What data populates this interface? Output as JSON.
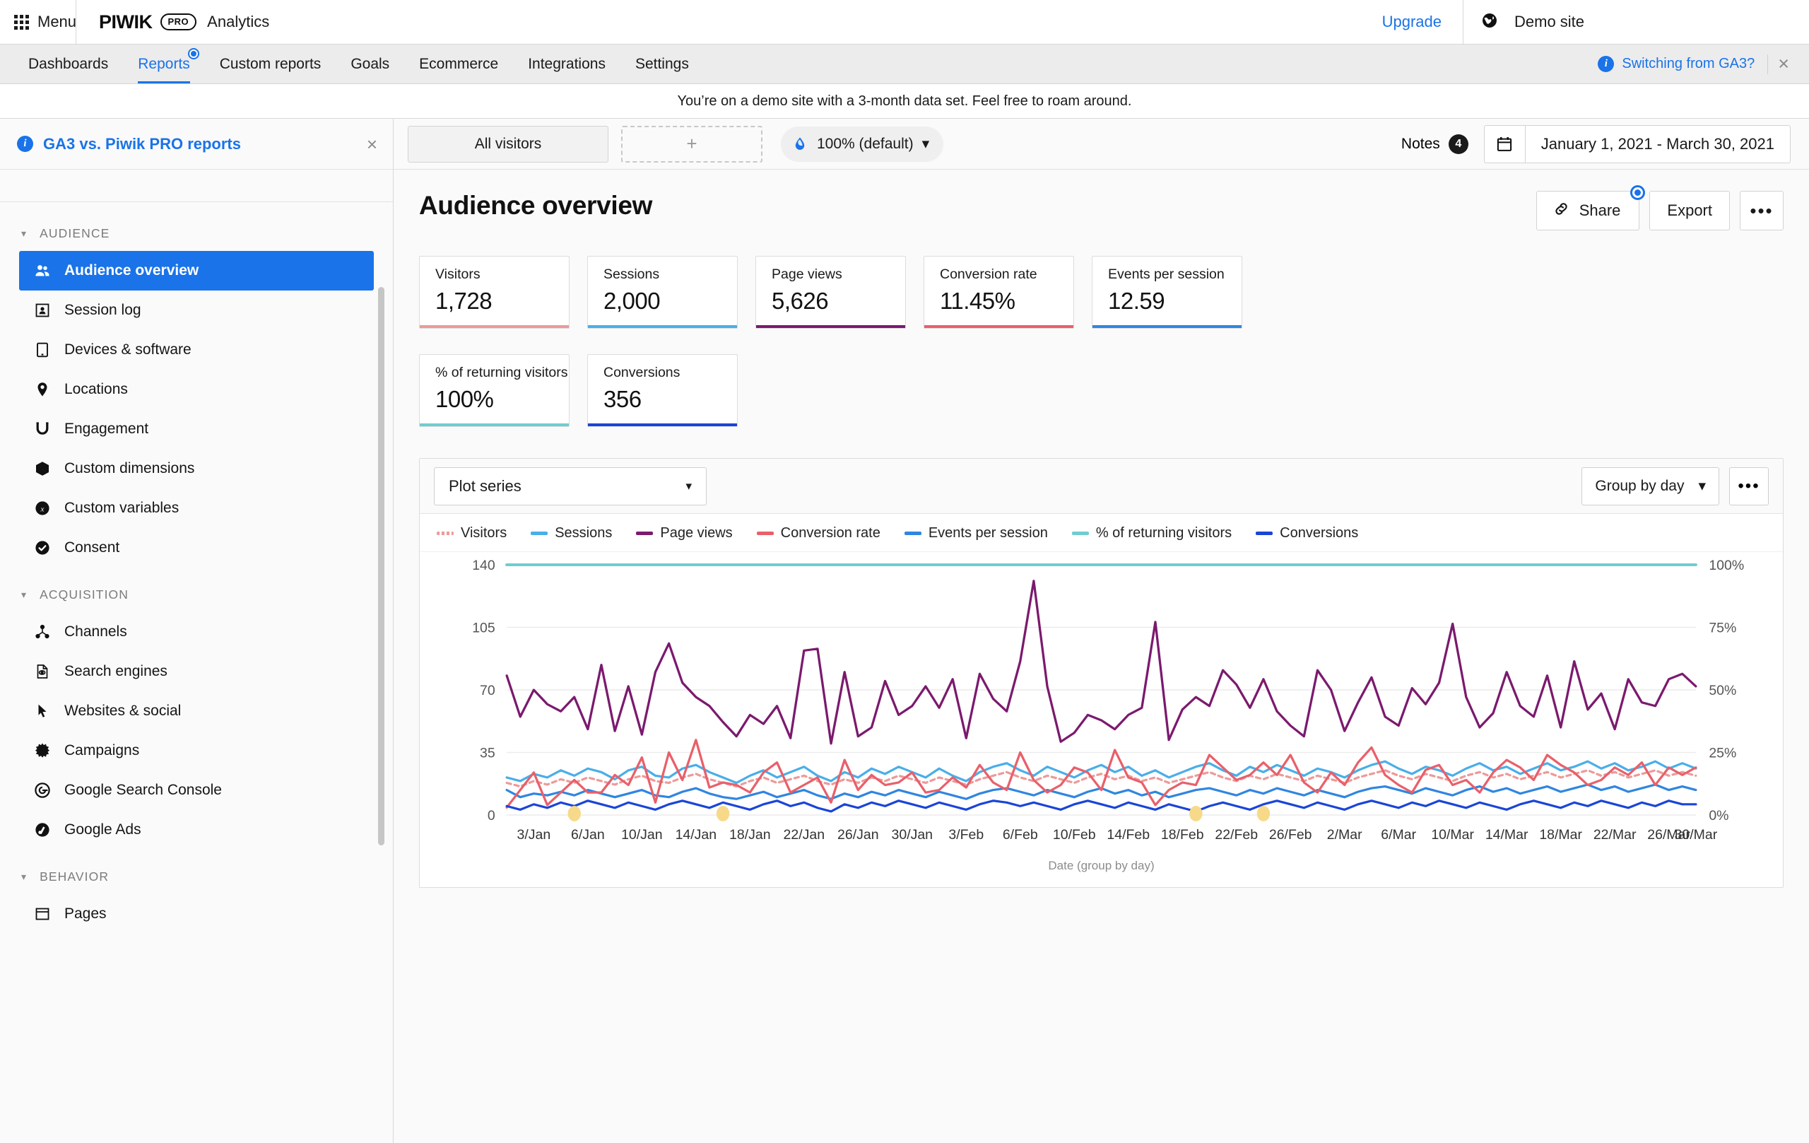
{
  "topbar": {
    "menu_label": "Menu",
    "brand_main": "PIWIK",
    "brand_badge": "PRO",
    "brand_product": "Analytics",
    "upgrade_label": "Upgrade",
    "site_name": "Demo site",
    "globe_icon": "globe-icon"
  },
  "nav": {
    "items": [
      {
        "label": "Dashboards",
        "active": false
      },
      {
        "label": "Reports",
        "active": true
      },
      {
        "label": "Custom reports",
        "active": false
      },
      {
        "label": "Goals",
        "active": false
      },
      {
        "label": "Ecommerce",
        "active": false
      },
      {
        "label": "Integrations",
        "active": false
      },
      {
        "label": "Settings",
        "active": false
      }
    ],
    "ga3_notice": "Switching from GA3?",
    "close_label": "×"
  },
  "demo_banner": {
    "text": "You’re on a demo site with a 3-month data set. Feel free to roam around."
  },
  "sidebar": {
    "notice_title": "GA3 vs. Piwik PRO reports",
    "notice_close": "×",
    "groups": [
      {
        "label": "AUDIENCE",
        "items": [
          {
            "label": "Audience overview",
            "icon": "people-icon",
            "active": true
          },
          {
            "label": "Session log",
            "icon": "person-card-icon",
            "active": false
          },
          {
            "label": "Devices & software",
            "icon": "tablet-icon",
            "active": false
          },
          {
            "label": "Locations",
            "icon": "map-pin-icon",
            "active": false
          },
          {
            "label": "Engagement",
            "icon": "magnet-icon",
            "active": false
          },
          {
            "label": "Custom dimensions",
            "icon": "cube-icon",
            "active": false
          },
          {
            "label": "Custom variables",
            "icon": "variable-x-icon",
            "active": false
          },
          {
            "label": "Consent",
            "icon": "check-circle-icon",
            "active": false
          }
        ]
      },
      {
        "label": "ACQUISITION",
        "items": [
          {
            "label": "Channels",
            "icon": "network-icon",
            "active": false
          },
          {
            "label": "Search engines",
            "icon": "search-page-icon",
            "active": false
          },
          {
            "label": "Websites & social",
            "icon": "cursor-arrow-icon",
            "active": false
          },
          {
            "label": "Campaigns",
            "icon": "burst-icon",
            "active": false
          },
          {
            "label": "Google Search Console",
            "icon": "google-g-icon",
            "active": false
          },
          {
            "label": "Google Ads",
            "icon": "google-ads-icon",
            "active": false
          }
        ]
      },
      {
        "label": "BEHAVIOR",
        "items": [
          {
            "label": "Pages",
            "icon": "pages-icon",
            "active": false
          }
        ]
      }
    ]
  },
  "toolbar": {
    "segment_label": "All visitors",
    "add_segment_label": "+",
    "sampling_label": "100% (default)",
    "sampling_icon": "droplet-icon",
    "notes_label": "Notes",
    "notes_count": "4",
    "calendar_icon": "calendar-icon",
    "date_range": "January 1, 2021 - March 30, 2021"
  },
  "page": {
    "title": "Audience overview",
    "share_label": "Share",
    "share_icon": "link-icon",
    "export_label": "Export",
    "more_label": "•••"
  },
  "kpis": [
    {
      "label": "Visitors",
      "value": "1,728",
      "color": "#ec9a9a"
    },
    {
      "label": "Sessions",
      "value": "2,000",
      "color": "#4aaee8"
    },
    {
      "label": "Page views",
      "value": "5,626",
      "color": "#7b1a6e"
    },
    {
      "label": "Conversion rate",
      "value": "11.45%",
      "color": "#e8606a"
    },
    {
      "label": "Events per session",
      "value": "12.59",
      "color": "#2f86e0"
    },
    {
      "label": "% of returning visitors",
      "value": "100%",
      "color": "#6fcdd0"
    },
    {
      "label": "Conversions",
      "value": "356",
      "color": "#1a45d8"
    }
  ],
  "chart_controls": {
    "plot_series_label": "Plot series",
    "group_by_label": "Group by day",
    "more_label": "•••"
  },
  "chart_data": {
    "type": "line",
    "title": "",
    "xlabel": "Date (group by day)",
    "ylabel": "",
    "grid": true,
    "legend_position": "top",
    "y_left_ticks": [
      "0",
      "35",
      "70",
      "105",
      "140"
    ],
    "y_left_lim": [
      0,
      140
    ],
    "y_right_ticks": [
      "0%",
      "25%",
      "50%",
      "75%",
      "100%"
    ],
    "y_right_lim": [
      0,
      100
    ],
    "x_tick_labels": [
      "3/Jan",
      "6/Jan",
      "10/Jan",
      "14/Jan",
      "18/Jan",
      "22/Jan",
      "26/Jan",
      "30/Jan",
      "3/Feb",
      "6/Feb",
      "10/Feb",
      "14/Feb",
      "18/Feb",
      "22/Feb",
      "26/Feb",
      "2/Mar",
      "6/Mar",
      "10/Mar",
      "14/Mar",
      "18/Mar",
      "22/Mar",
      "26/Mar",
      "30/Mar"
    ],
    "x_start": "1/Jan",
    "x_end": "30/Mar",
    "n_points": 89,
    "annotation_markers": [
      {
        "x_index": 5,
        "label": "note-marker"
      },
      {
        "x_index": 16,
        "label": "note-marker"
      },
      {
        "x_index": 51,
        "label": "note-marker"
      },
      {
        "x_index": 56,
        "label": "note-marker"
      }
    ],
    "series": [
      {
        "name": "Visitors",
        "color": "#ec9a9a",
        "axis": "left",
        "dashed": true,
        "values": [
          18,
          16,
          19,
          17,
          20,
          18,
          21,
          19,
          17,
          20,
          22,
          19,
          18,
          21,
          23,
          20,
          18,
          16,
          19,
          21,
          18,
          20,
          22,
          19,
          17,
          20,
          18,
          21,
          19,
          22,
          20,
          18,
          21,
          19,
          17,
          20,
          22,
          24,
          21,
          19,
          22,
          20,
          18,
          21,
          23,
          20,
          22,
          19,
          21,
          18,
          20,
          22,
          24,
          21,
          19,
          22,
          20,
          23,
          21,
          19,
          22,
          20,
          18,
          21,
          23,
          25,
          22,
          20,
          23,
          21,
          19,
          22,
          24,
          21,
          23,
          20,
          22,
          24,
          21,
          23,
          25,
          22,
          24,
          21,
          23,
          25,
          22,
          24,
          22
        ]
      },
      {
        "name": "Sessions",
        "color": "#4aaee8",
        "axis": "left",
        "values": [
          21,
          19,
          23,
          21,
          25,
          22,
          26,
          24,
          20,
          25,
          27,
          22,
          21,
          26,
          28,
          24,
          21,
          18,
          22,
          25,
          21,
          24,
          27,
          22,
          19,
          24,
          21,
          26,
          23,
          27,
          24,
          21,
          26,
          22,
          19,
          24,
          27,
          29,
          25,
          22,
          27,
          24,
          21,
          25,
          28,
          24,
          27,
          22,
          25,
          21,
          24,
          27,
          29,
          25,
          22,
          27,
          24,
          28,
          25,
          22,
          26,
          24,
          21,
          25,
          28,
          30,
          26,
          23,
          27,
          25,
          22,
          26,
          29,
          25,
          27,
          23,
          26,
          29,
          25,
          27,
          30,
          26,
          29,
          25,
          27,
          30,
          26,
          29,
          26
        ]
      },
      {
        "name": "Page views",
        "color": "#7b1a6e",
        "axis": "left",
        "values": [
          78,
          55,
          70,
          62,
          58,
          66,
          48,
          84,
          47,
          72,
          45,
          80,
          96,
          74,
          66,
          61,
          52,
          44,
          56,
          51,
          61,
          43,
          92,
          93,
          40,
          80,
          44,
          49,
          75,
          56,
          61,
          72,
          60,
          76,
          43,
          79,
          65,
          58,
          86,
          131,
          72,
          41,
          46,
          56,
          53,
          48,
          56,
          60,
          108,
          42,
          59,
          66,
          61,
          81,
          73,
          60,
          76,
          58,
          50,
          44,
          81,
          70,
          47,
          63,
          77,
          55,
          50,
          71,
          62,
          74,
          107,
          66,
          49,
          57,
          80,
          61,
          55,
          78,
          49,
          86,
          59,
          68,
          48,
          76,
          63,
          61,
          76,
          79,
          72
        ]
      },
      {
        "name": "Conversion rate",
        "color": "#e8606a",
        "axis": "right",
        "values": [
          3,
          10,
          17,
          4,
          9,
          14,
          9,
          9,
          16,
          12,
          23,
          5,
          25,
          14,
          30,
          11,
          13,
          12,
          9,
          17,
          21,
          9,
          12,
          15,
          5,
          22,
          10,
          16,
          12,
          13,
          17,
          9,
          10,
          15,
          11,
          20,
          13,
          10,
          25,
          14,
          9,
          12,
          19,
          17,
          10,
          26,
          15,
          13,
          4,
          10,
          13,
          12,
          24,
          19,
          14,
          16,
          21,
          16,
          24,
          13,
          9,
          17,
          12,
          21,
          27,
          16,
          12,
          9,
          18,
          20,
          12,
          14,
          9,
          17,
          22,
          19,
          14,
          24,
          20,
          17,
          12,
          14,
          19,
          16,
          21,
          12,
          19,
          16,
          19
        ]
      },
      {
        "name": "Events per session",
        "color": "#2f86e0",
        "axis": "left",
        "values": [
          14,
          10,
          12,
          11,
          13,
          11,
          14,
          12,
          10,
          12,
          14,
          11,
          10,
          13,
          15,
          12,
          10,
          9,
          11,
          13,
          10,
          12,
          14,
          11,
          9,
          12,
          10,
          13,
          11,
          14,
          12,
          10,
          13,
          11,
          9,
          12,
          14,
          15,
          13,
          11,
          14,
          12,
          10,
          13,
          15,
          12,
          14,
          11,
          13,
          10,
          12,
          14,
          15,
          13,
          11,
          14,
          12,
          15,
          13,
          11,
          14,
          12,
          10,
          13,
          15,
          16,
          14,
          12,
          15,
          13,
          11,
          14,
          16,
          13,
          15,
          12,
          14,
          16,
          13,
          15,
          17,
          14,
          16,
          13,
          15,
          17,
          14,
          16,
          14
        ]
      },
      {
        "name": "% of returning visitors",
        "color": "#6fcdd0",
        "axis": "right",
        "values": [
          100,
          100,
          100,
          100,
          100,
          100,
          100,
          100,
          100,
          100,
          100,
          100,
          100,
          100,
          100,
          100,
          100,
          100,
          100,
          100,
          100,
          100,
          100,
          100,
          100,
          100,
          100,
          100,
          100,
          100,
          100,
          100,
          100,
          100,
          100,
          100,
          100,
          100,
          100,
          100,
          100,
          100,
          100,
          100,
          100,
          100,
          100,
          100,
          100,
          100,
          100,
          100,
          100,
          100,
          100,
          100,
          100,
          100,
          100,
          100,
          100,
          100,
          100,
          100,
          100,
          100,
          100,
          100,
          100,
          100,
          100,
          100,
          100,
          100,
          100,
          100,
          100,
          100,
          100,
          100,
          100,
          100,
          100,
          100,
          100,
          100,
          100,
          100,
          100
        ]
      },
      {
        "name": "Conversions",
        "color": "#1a45d8",
        "axis": "left",
        "values": [
          5,
          3,
          6,
          4,
          7,
          5,
          8,
          6,
          4,
          7,
          5,
          3,
          6,
          8,
          6,
          4,
          7,
          5,
          3,
          6,
          8,
          5,
          7,
          4,
          2,
          6,
          4,
          7,
          5,
          8,
          6,
          4,
          7,
          5,
          3,
          6,
          8,
          7,
          5,
          7,
          5,
          3,
          6,
          8,
          6,
          4,
          7,
          5,
          3,
          6,
          4,
          2,
          5,
          7,
          5,
          3,
          6,
          8,
          6,
          4,
          7,
          5,
          3,
          6,
          8,
          6,
          4,
          7,
          5,
          8,
          6,
          4,
          7,
          5,
          3,
          6,
          8,
          6,
          4,
          7,
          5,
          8,
          6,
          4,
          7,
          5,
          8,
          6,
          6
        ]
      }
    ]
  }
}
